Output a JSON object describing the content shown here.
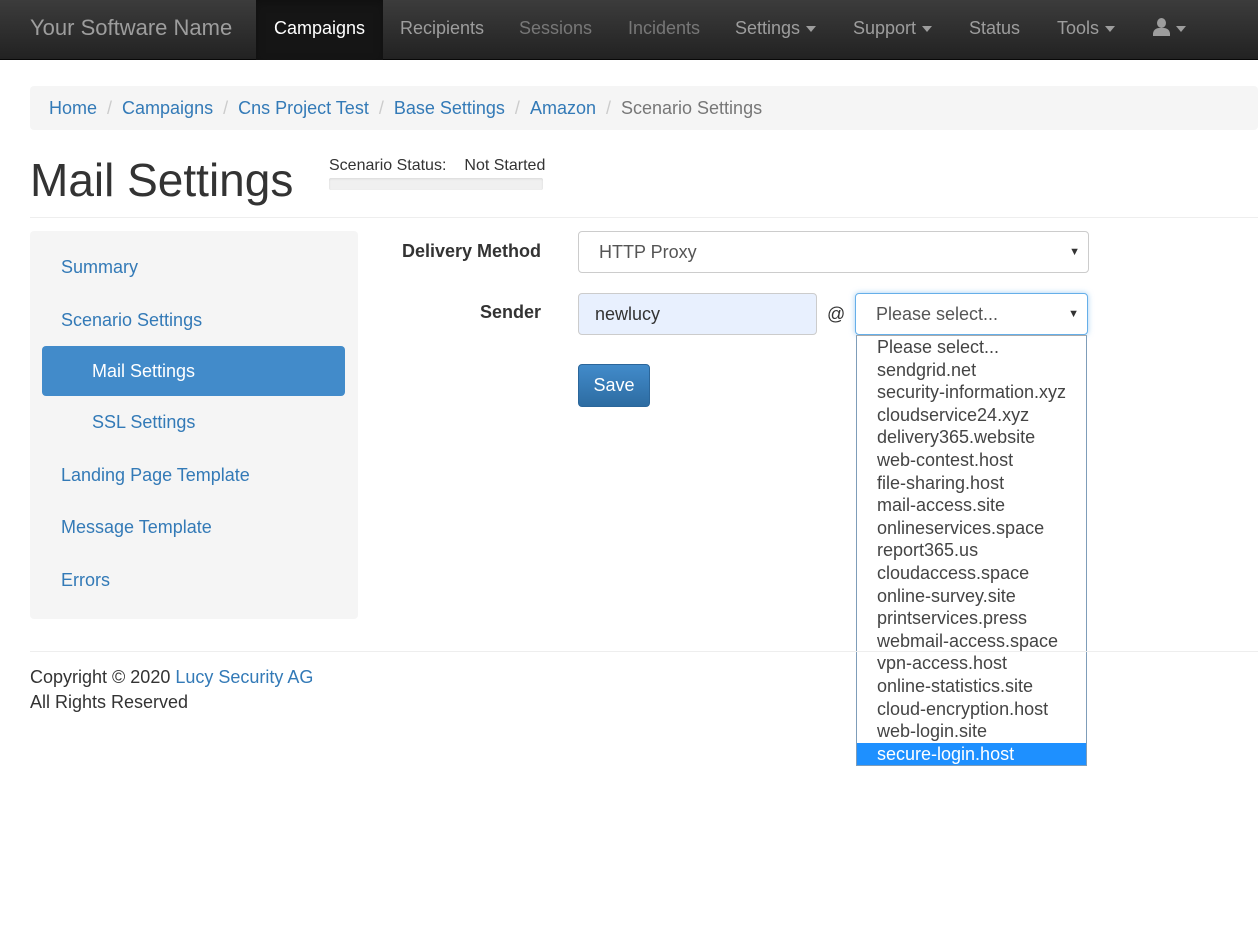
{
  "navbar": {
    "brand": "Your Software Name",
    "items": [
      {
        "label": "Campaigns",
        "state": "active"
      },
      {
        "label": "Recipients",
        "state": "normal"
      },
      {
        "label": "Sessions",
        "state": "disabled"
      },
      {
        "label": "Incidents",
        "state": "disabled"
      },
      {
        "label": "Settings",
        "state": "dropdown"
      },
      {
        "label": "Support",
        "state": "dropdown"
      },
      {
        "label": "Status",
        "state": "normal"
      },
      {
        "label": "Tools",
        "state": "dropdown"
      }
    ],
    "user_icon": "user-icon"
  },
  "breadcrumb": [
    "Home",
    "Campaigns",
    "Cns Project Test",
    "Base Settings",
    "Amazon",
    "Scenario Settings"
  ],
  "breadcrumb_separator": "/",
  "page": {
    "title": "Mail Settings",
    "status_label": "Scenario Status:",
    "status_value": "Not Started"
  },
  "sidebar": {
    "items": [
      {
        "label": "Summary"
      },
      {
        "label": "Scenario Settings"
      },
      {
        "label": "Mail Settings",
        "active": true
      },
      {
        "label": "SSL Settings"
      },
      {
        "label": "Landing Page Template"
      },
      {
        "label": "Message Template"
      },
      {
        "label": "Errors"
      }
    ]
  },
  "form": {
    "delivery_method_label": "Delivery Method",
    "delivery_method_value": "HTTP Proxy",
    "sender_label": "Sender",
    "sender_value": "newlucy",
    "at_sign": "@",
    "domain_value": "Please select...",
    "save_label": "Save"
  },
  "domain_options": [
    "Please select...",
    "sendgrid.net",
    "security-information.xyz",
    "cloudservice24.xyz",
    "delivery365.website",
    "web-contest.host",
    "file-sharing.host",
    "mail-access.site",
    "onlineservices.space",
    "report365.us",
    "cloudaccess.space",
    "online-survey.site",
    "printservices.press",
    "webmail-access.space",
    "vpn-access.host",
    "online-statistics.site",
    "cloud-encryption.host",
    "web-login.site",
    "secure-login.host"
  ],
  "domain_highlighted": "secure-login.host",
  "footer": {
    "copyright": "Copyright © 2020",
    "company": "Lucy Security AG",
    "rights": "All Rights Reserved"
  },
  "colors": {
    "link": "#337ab7",
    "active_item": "#428bca",
    "navbar": "#222222",
    "highlight": "#1e90ff"
  }
}
